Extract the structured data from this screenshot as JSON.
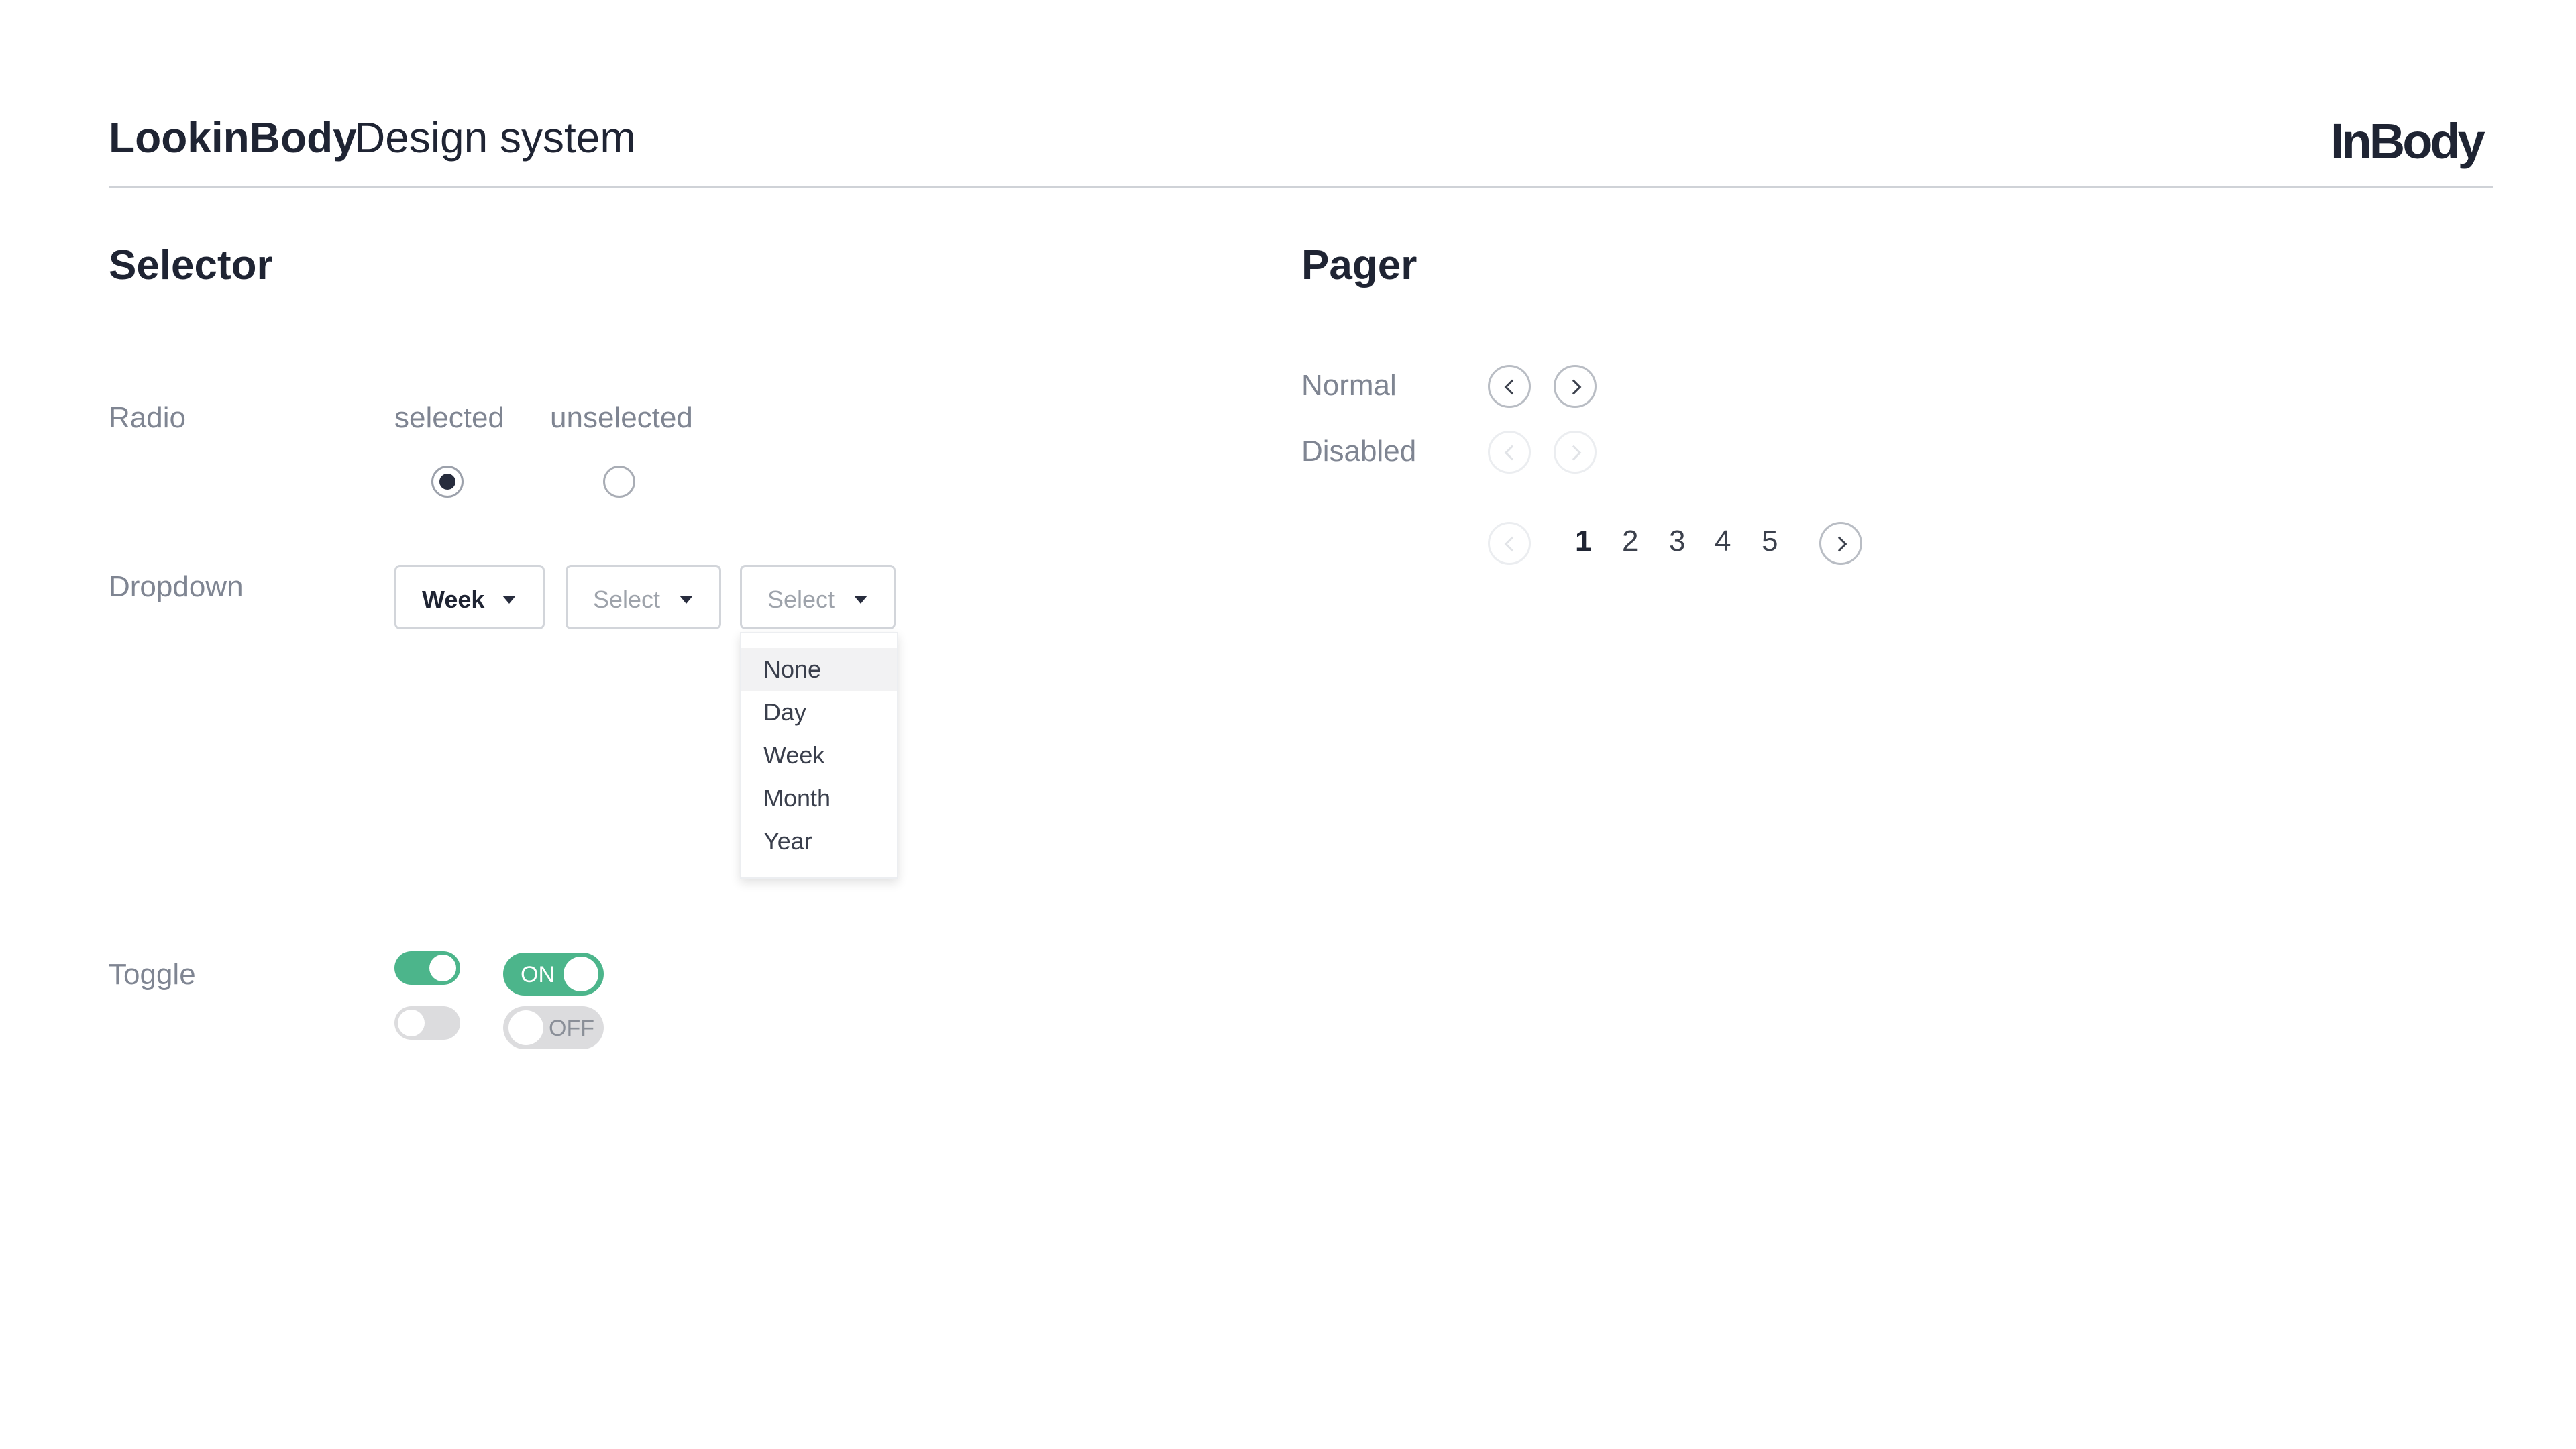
{
  "header": {
    "brand": "LookinBody",
    "subtitle": "Design system",
    "logo": "InBody"
  },
  "selector": {
    "title": "Selector",
    "radio": {
      "label": "Radio",
      "selected_label": "selected",
      "unselected_label": "unselected"
    },
    "dropdown": {
      "label": "Dropdown",
      "boxes": [
        {
          "value": "Week"
        },
        {
          "placeholder": "Select"
        },
        {
          "placeholder": "Select"
        }
      ],
      "menu_options": [
        "None",
        "Day",
        "Week",
        "Month",
        "Year"
      ],
      "highlighted_option": "None"
    },
    "toggle": {
      "label": "Toggle",
      "on_text": "ON",
      "off_text": "OFF",
      "on_color": "#4cb58b",
      "off_color": "#dcdcde"
    }
  },
  "pager": {
    "title": "Pager",
    "normal_label": "Normal",
    "disabled_label": "Disabled",
    "pages": [
      "1",
      "2",
      "3",
      "4",
      "5"
    ],
    "current_page": "1"
  },
  "icons": {
    "prev": "chevron-left-icon",
    "next": "chevron-right-icon",
    "caret": "caret-down-icon"
  }
}
